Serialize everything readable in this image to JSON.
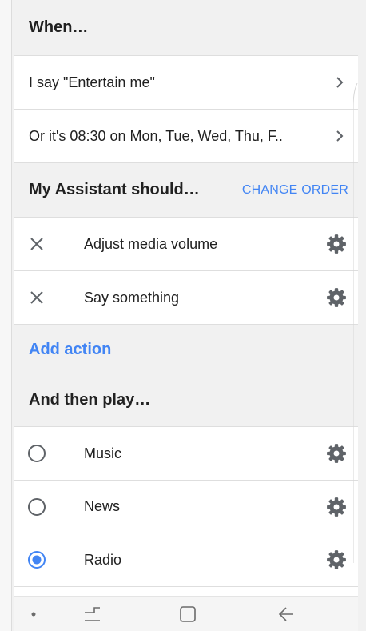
{
  "when_header": "When…",
  "triggers": [
    {
      "label": "I say \"Entertain me\""
    },
    {
      "label": "Or it's 08:30 on Mon, Tue, Wed, Thu, F.."
    }
  ],
  "assistant_header": "My Assistant should…",
  "change_order": "CHANGE ORDER",
  "actions": [
    {
      "label": "Adjust media volume"
    },
    {
      "label": "Say something"
    }
  ],
  "add_action": "Add action",
  "then_play_header": "And then play…",
  "play_options": [
    {
      "label": "Music",
      "selected": false
    },
    {
      "label": "News",
      "selected": false
    },
    {
      "label": "Radio",
      "selected": true
    }
  ],
  "colors": {
    "accent": "#4285f4",
    "gear": "#5f6368",
    "background": "#f1f1f1"
  }
}
